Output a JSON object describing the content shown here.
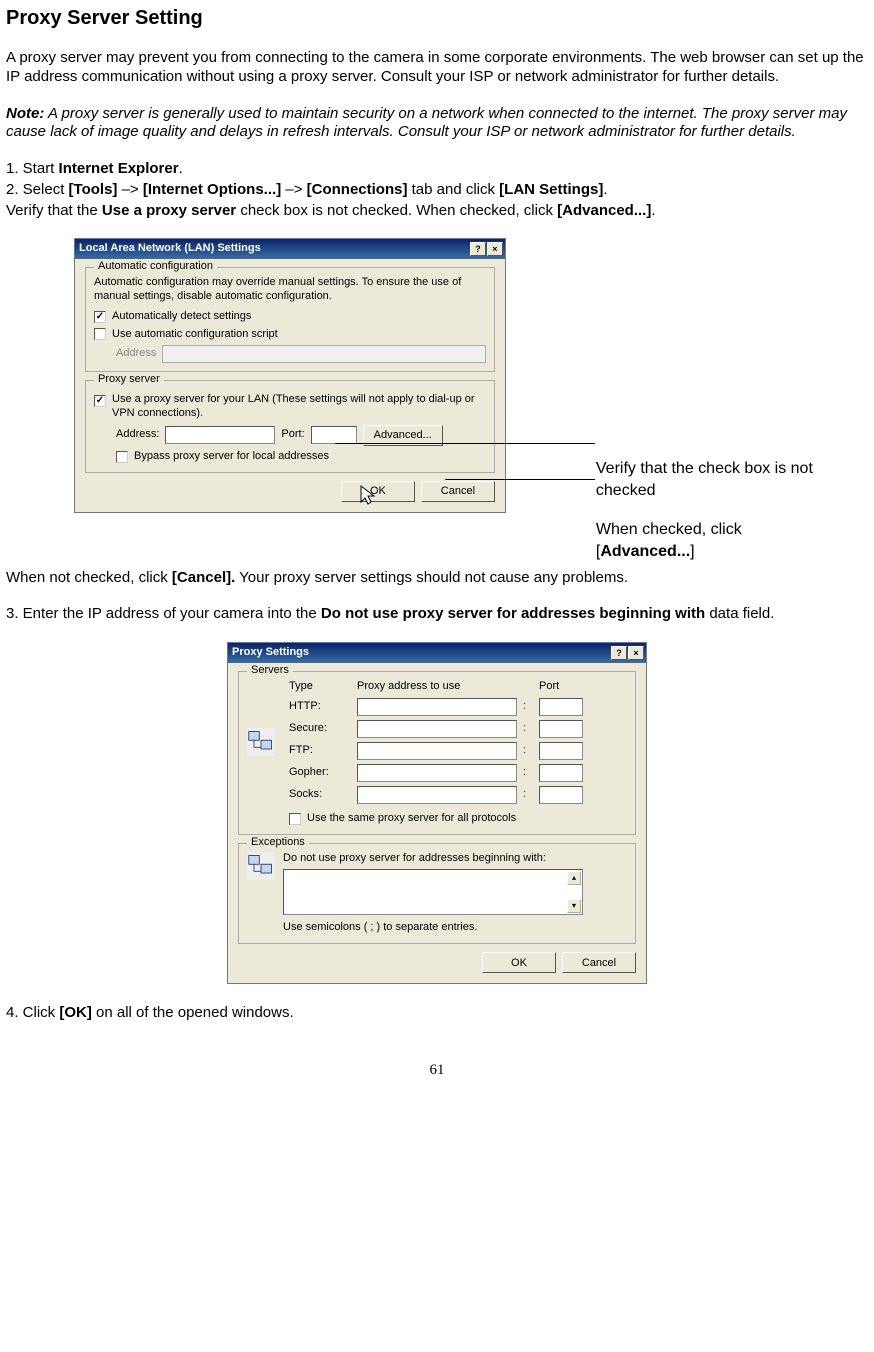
{
  "heading": "Proxy Server Setting",
  "para1": "A proxy server may prevent you from connecting to the camera in some corporate environments. The web browser can set up the IP address communication without using a proxy server. Consult your ISP or network administrator for further details.",
  "note_prefix": "Note:",
  "note_body": " A proxy server is generally used to maintain security on a network when connected to the internet. The proxy server may cause lack of image quality and delays in refresh intervals. Consult your ISP or network administrator for further details.",
  "step1_a": "1. Start ",
  "step1_b": "Internet Explorer",
  "step1_c": ".",
  "step2_a": "2. Select ",
  "step2_b": "[Tools]",
  "step2_c": " –> ",
  "step2_d": "[Internet Options...]",
  "step2_e": " –> ",
  "step2_f": "[Connections]",
  "step2_g": " tab and click ",
  "step2_h": "[LAN Settings]",
  "step2_i": ".",
  "verify_a": "Verify that the ",
  "verify_b": "Use a proxy server",
  "verify_c": " check box is not checked. When checked, click ",
  "verify_d": "[Advanced...]",
  "verify_e": ".",
  "dlg1": {
    "title": "Local Area Network (LAN) Settings",
    "auto_group": "Automatic configuration",
    "auto_desc": "Automatic configuration may override manual settings. To ensure the use of manual settings, disable automatic configuration.",
    "auto_detect": "Automatically detect settings",
    "auto_script": "Use automatic configuration script",
    "address_label": "Address",
    "proxy_group": "Proxy server",
    "proxy_use": "Use a proxy server for your LAN (These settings will not apply to dial-up or VPN connections).",
    "proxy_addr": "Address:",
    "proxy_port": "Port:",
    "advanced_btn": "Advanced...",
    "bypass": "Bypass proxy server for local addresses",
    "ok": "OK",
    "cancel": "Cancel"
  },
  "callout_line1": "Verify that the check box is not checked",
  "callout_line2": "When checked, click",
  "callout_line3_a": "[",
  "callout_line3_b": "Advanced...",
  "callout_line3_c": "]",
  "after_fig1_a": "When not checked, click ",
  "after_fig1_b": "[Cancel].",
  "after_fig1_c": " Your proxy server settings should not cause any problems.",
  "step3_a": "3. Enter the IP address of your camera into the ",
  "step3_b": "Do not use proxy server for addresses beginning with",
  "step3_c": " data field.",
  "dlg2": {
    "title": "Proxy Settings",
    "servers_group": "Servers",
    "hdr_type": "Type",
    "hdr_addr": "Proxy address to use",
    "hdr_port": "Port",
    "http": "HTTP:",
    "secure": "Secure:",
    "ftp": "FTP:",
    "gopher": "Gopher:",
    "socks": "Socks:",
    "same_proxy": "Use the same proxy server for all protocols",
    "exc_group": "Exceptions",
    "exc_label": "Do not use proxy server for addresses beginning with:",
    "exc_hint": "Use semicolons ( ; ) to separate entries.",
    "ok": "OK",
    "cancel": "Cancel"
  },
  "step4_a": "4. Click ",
  "step4_b": "[OK]",
  "step4_c": " on all of the opened windows.",
  "page_num": "61"
}
